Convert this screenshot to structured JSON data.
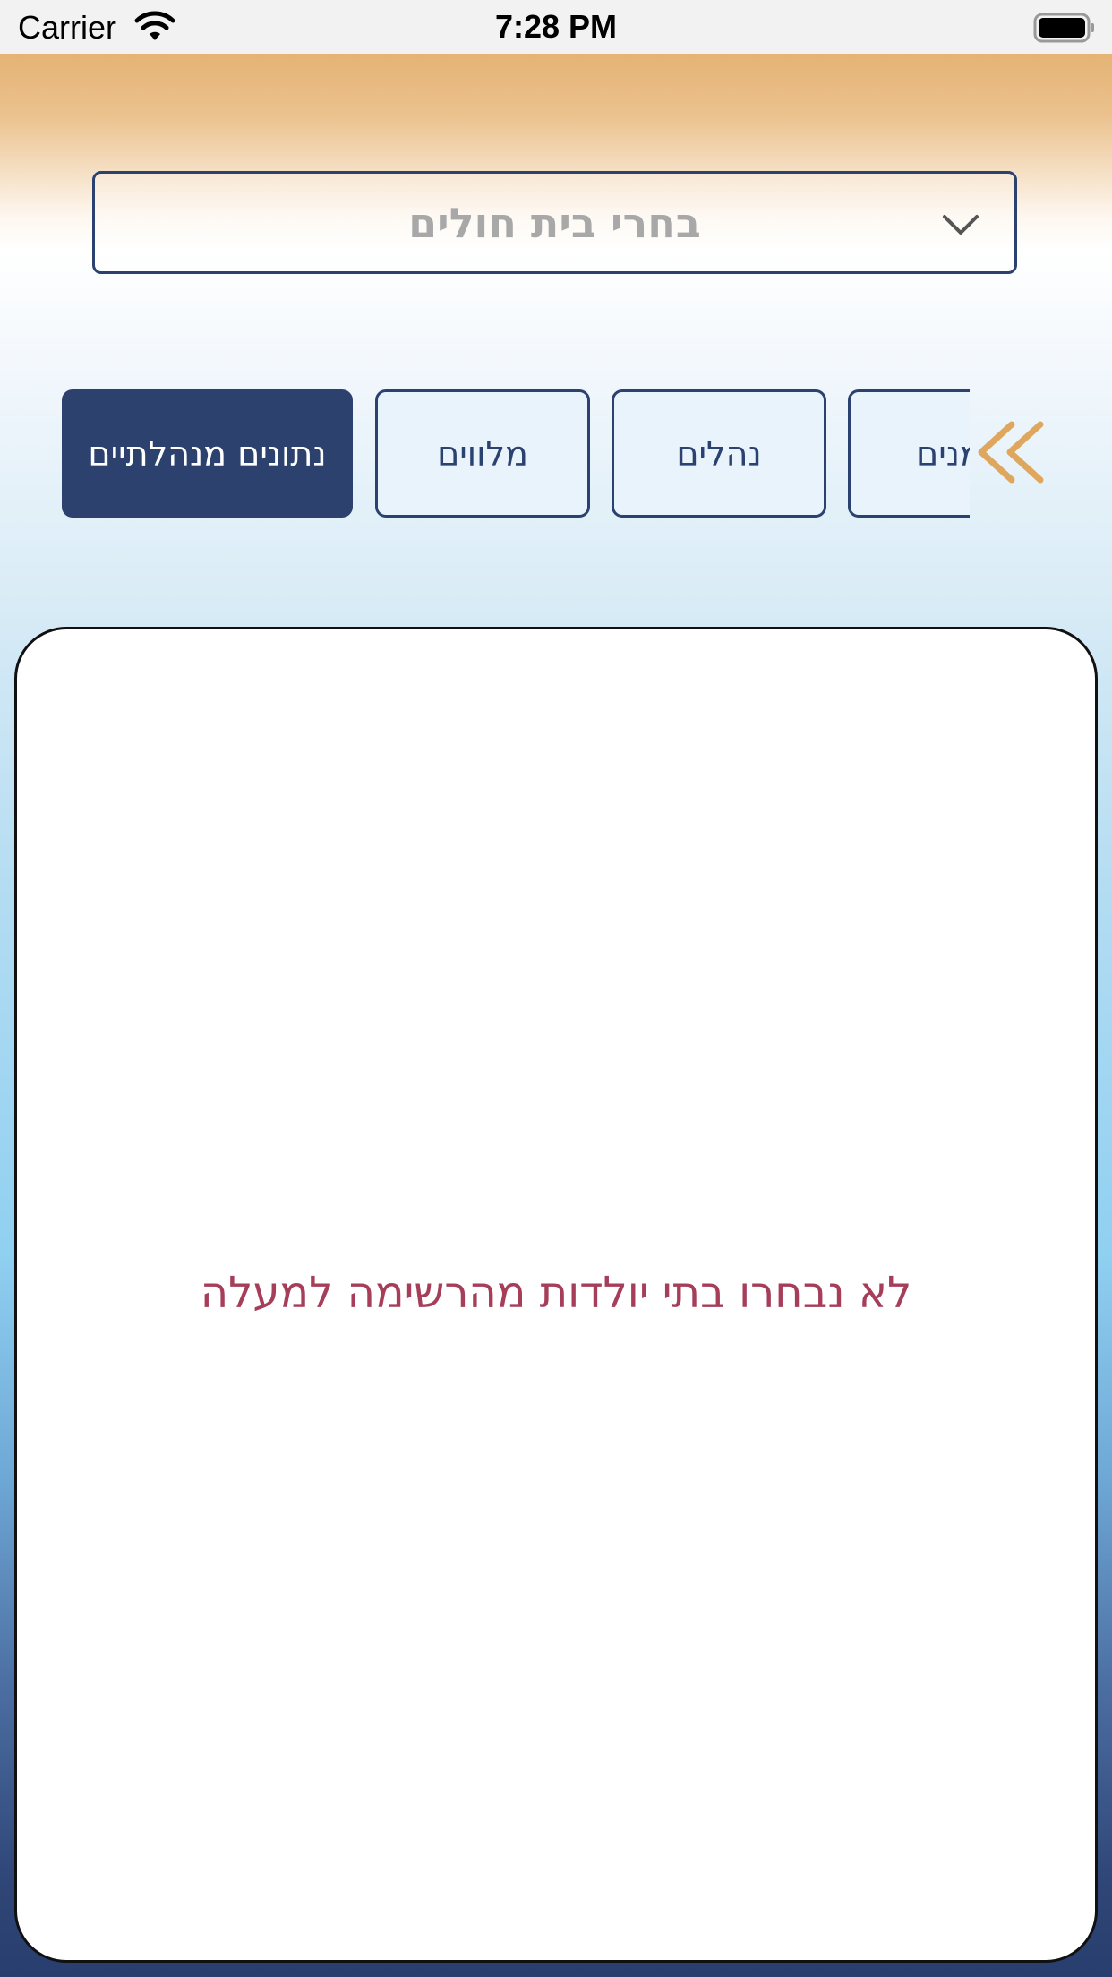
{
  "status_bar": {
    "carrier": "Carrier",
    "time": "7:28 PM",
    "icons": [
      "wifi-icon",
      "battery-icon"
    ]
  },
  "hospital_select": {
    "placeholder": "בחרי בית חולים",
    "icon": "chevron-down-icon"
  },
  "tabs": [
    {
      "label": "נתונים מנהלתיים",
      "active": true
    },
    {
      "label": "מלווים",
      "active": false
    },
    {
      "label": "נהלים",
      "active": false
    },
    {
      "label": "זמנים",
      "active": false
    }
  ],
  "tabs_scroll_icon": "double-chevron-left-icon",
  "content": {
    "empty_message": "לא נבחרו בתי יולדות מהרשימה למעלה"
  },
  "colors": {
    "primary_navy": "#2c416e",
    "accent_orange": "#dfa65e",
    "message_red": "#a63d59",
    "placeholder_gray": "#a8a8a8"
  }
}
